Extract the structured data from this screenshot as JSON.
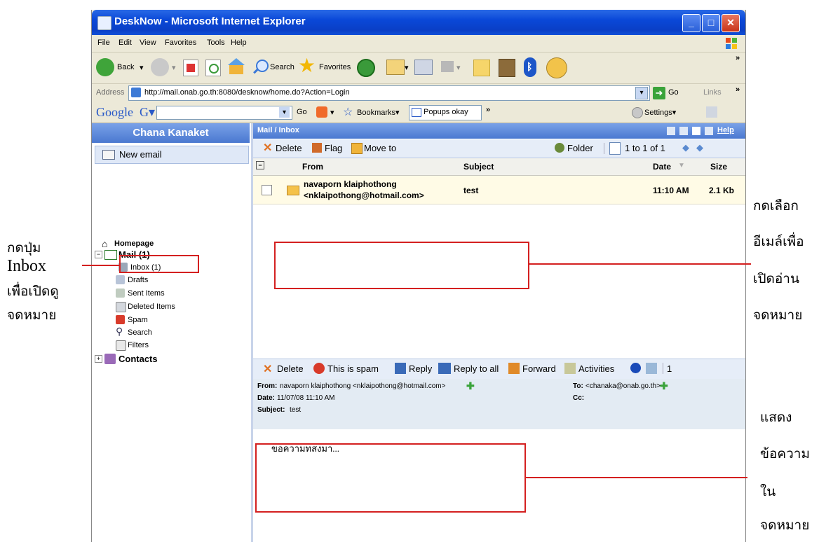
{
  "window": {
    "title": "DeskNow - Microsoft Internet Explorer",
    "minimize": "_",
    "maximize": "□",
    "close": "✕"
  },
  "menubar": [
    "File",
    "Edit",
    "View",
    "Favorites",
    "Tools",
    "Help"
  ],
  "toolbar": {
    "back": "Back",
    "search": "Search",
    "favorites": "Favorites",
    "more": "»"
  },
  "addressbar": {
    "label": "Address",
    "url": "http://mail.onab.go.th:8080/desknow/home.do?Action=Login",
    "go": "Go",
    "links": "Links",
    "more": "»"
  },
  "googlebar": {
    "logo": "Google",
    "g_button": "G▾",
    "go": "Go",
    "bookmarks": "Bookmarks▾",
    "popups": "Popups okay",
    "more": "»",
    "settings": "Settings▾"
  },
  "sidebar": {
    "user": "Chana Kanaket",
    "new_email": "New email",
    "homepage": "Homepage",
    "mail": "Mail (1)",
    "items": [
      "Inbox (1)",
      "Drafts",
      "Sent Items",
      "Deleted Items",
      "Spam",
      "Search",
      "Filters"
    ],
    "contacts": "Contacts"
  },
  "mail": {
    "breadcrumb": "Mail / Inbox",
    "help": "Help",
    "toolbar": {
      "delete": "Delete",
      "flag": "Flag",
      "move_to": "Move to",
      "folder": "Folder",
      "paging": "1 to 1 of 1"
    },
    "columns": {
      "from": "From",
      "subject": "Subject",
      "date": "Date",
      "size": "Size"
    },
    "rows": [
      {
        "from_name": "navaporn klaiphothong",
        "from_email": "<nklaipothong@hotmail.com>",
        "subject": "test",
        "date": "11:10 AM",
        "size": "2.1 Kb"
      }
    ]
  },
  "preview": {
    "toolbar": {
      "delete": "Delete",
      "spam": "This is spam",
      "reply": "Reply",
      "reply_all": "Reply to all",
      "forward": "Forward",
      "activities": "Activities",
      "count": "1"
    },
    "from_label": "From:",
    "from_value": "navaporn klaiphothong <nklaipothong@hotmail.com>",
    "to_label": "To:",
    "to_value": "<chanaka@onab.go.th>",
    "date_label": "Date:",
    "date_value": "11/07/08 11:10 AM",
    "cc_label": "Cc:",
    "subject_label": "Subject:",
    "subject_value": "test",
    "body": "ขอความทสงมา..."
  },
  "annotations": {
    "inbox": [
      "กดปุ่ม",
      "Inbox",
      "เพื่อเปิดดู",
      "จดหมาย"
    ],
    "open_mail": [
      "กดเลือก",
      "อีเมล์เพื่อ",
      "เปิดอ่าน",
      "จดหมาย"
    ],
    "show_message": [
      "แสดง",
      "ข้อความ",
      "ใน",
      "จดหมาย"
    ]
  },
  "colors": {
    "titlebar": "#0a48d8",
    "accent": "#4a78d0",
    "annotation_red": "#d42020"
  }
}
